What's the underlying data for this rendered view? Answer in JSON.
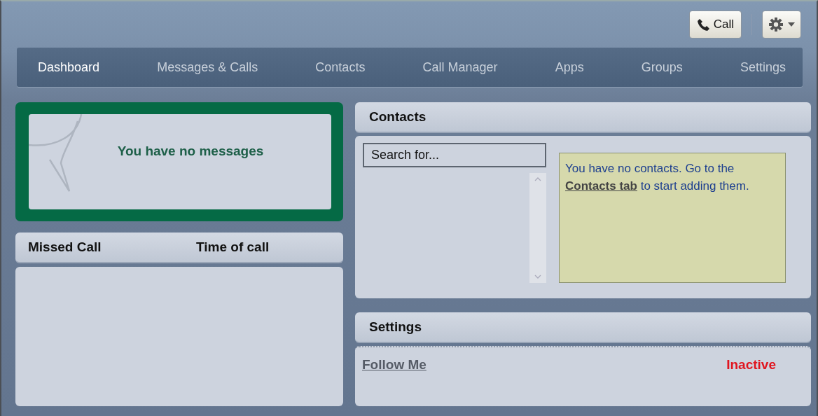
{
  "toolbar": {
    "call_button": "Call"
  },
  "nav": [
    {
      "label": "Dashboard",
      "selected": true
    },
    {
      "label": "Messages & Calls",
      "selected": false
    },
    {
      "label": "Contacts",
      "selected": false
    },
    {
      "label": "Call Manager",
      "selected": false
    },
    {
      "label": "Apps",
      "selected": false
    },
    {
      "label": "Groups",
      "selected": false
    },
    {
      "label": "Settings",
      "selected": false
    }
  ],
  "messages": {
    "text": "You have no messages"
  },
  "missed_calls": {
    "columns": [
      "Missed Call",
      "Time of call"
    ]
  },
  "contacts": {
    "title": "Contacts",
    "search": {
      "placeholder": "Search for..."
    },
    "notice": {
      "before": "You have no contacts. Go to the ",
      "link": "Contacts tab",
      "after": " to start adding them."
    }
  },
  "settings": {
    "title": "Settings",
    "items": [
      {
        "label": "Follow Me",
        "status": "Inactive",
        "active": false
      }
    ]
  }
}
